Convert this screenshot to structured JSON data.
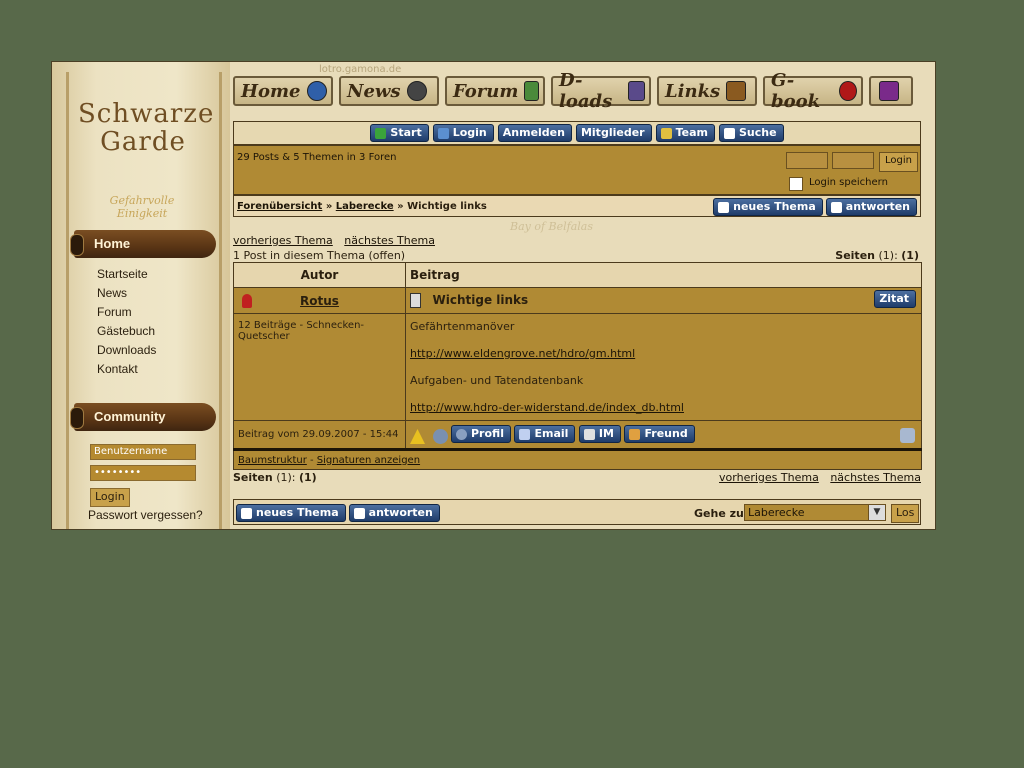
{
  "site": {
    "domain": "lotro.gamona.de"
  },
  "brand": {
    "line1": "Schwarze",
    "line2": "Garde",
    "subtitle": "Gefahrvolle Einigkeit"
  },
  "sidebar": {
    "home_header": "Home",
    "nav_items": [
      "Startseite",
      "News",
      "Forum",
      "Gästebuch",
      "Downloads",
      "Kontakt"
    ],
    "community_header": "Community",
    "username_placeholder": "Benutzername",
    "password_value": "••••••••",
    "login_button": "Login",
    "forgot_password": "Passwort vergessen?"
  },
  "topnav": {
    "tabs": [
      {
        "label": "Home",
        "icon": "globe-orb-icon",
        "color": "#2f5fa8"
      },
      {
        "label": "News",
        "icon": "dark-orb-icon",
        "color": "#444444"
      },
      {
        "label": "Forum",
        "icon": "quill-icon",
        "color": "#4a8a3a"
      },
      {
        "label": "D-loads",
        "icon": "scroll-icon",
        "color": "#5a4a8a"
      },
      {
        "label": "Links",
        "icon": "chest-icon",
        "color": "#8a5a20"
      },
      {
        "label": "G-book",
        "icon": "red-orb-icon",
        "color": "#b01818"
      },
      {
        "label": "",
        "icon": "book-icon",
        "color": "#7a2a8a"
      }
    ]
  },
  "forum_nav": {
    "buttons": [
      {
        "label": "Start",
        "icon": "runner-icon",
        "color": "#3aa33a"
      },
      {
        "label": "Login",
        "icon": "arrow-icon",
        "color": "#5b8fd0"
      },
      {
        "label": "Anmelden",
        "icon": "",
        "color": ""
      },
      {
        "label": "Mitglieder",
        "icon": "",
        "color": ""
      },
      {
        "label": "Team",
        "icon": "team-icon",
        "color": "#e0c040"
      },
      {
        "label": "Suche",
        "icon": "search-icon",
        "color": "#ffffff"
      }
    ]
  },
  "info_bar": {
    "stats": "29 Posts & 5 Themen in 3 Foren",
    "login_button": "Login",
    "remember_label": "Login speichern"
  },
  "breadcrumb": {
    "root": "Forenübersicht",
    "sep": "»",
    "forum": "Laberecke",
    "topic": "Wichtige links",
    "new_topic": "neues Thema",
    "reply": "antworten"
  },
  "topic": {
    "prev": "vorheriges Thema",
    "next": "nächstes Thema",
    "post_count": "1 Post in diesem Thema (offen)",
    "pages_label": "Seiten",
    "pages_total": "(1):",
    "pages_current": "(1)"
  },
  "post_table": {
    "col_author": "Autor",
    "col_post": "Beitrag",
    "author_name": "Rotus",
    "post_title": "Wichtige links",
    "quote_button": "Zitat",
    "author_info": "12 Beiträge - Schnecken-Quetscher",
    "body": {
      "line1": "Gefährtenmanöver",
      "link1": "http://www.eldengrove.net/hdro/gm.html",
      "line2": "Aufgaben- und Tatendatenbank",
      "link2": "http://www.hdro-der-widerstand.de/index_db.html"
    },
    "post_date": "Beitrag vom 29.09.2007 - 15:44",
    "actions": {
      "profile": "Profil",
      "email": "Email",
      "im": "IM",
      "friend": "Freund"
    },
    "tree": "Baumstruktur",
    "tree_sep": "-",
    "signatures": "Signaturen anzeigen"
  },
  "footer": {
    "pages_label": "Seiten",
    "pages_total": "(1):",
    "pages_current": "(1)",
    "prev": "vorheriges Thema",
    "next": "nächstes Thema",
    "new_topic": "neues Thema",
    "reply": "antworten",
    "jump_label": "Gehe zu:",
    "jump_value": "Laberecke",
    "jump_button": "Los"
  }
}
